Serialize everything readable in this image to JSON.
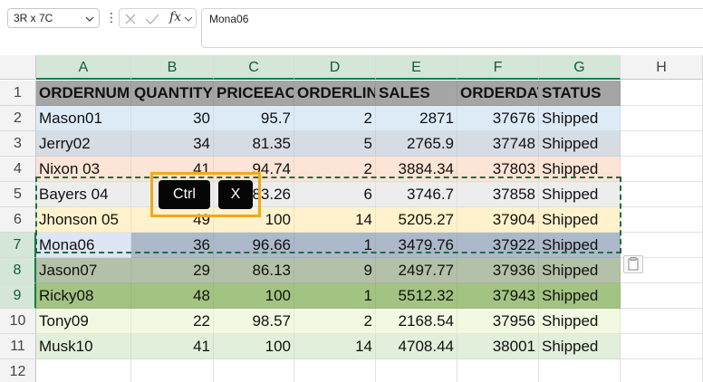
{
  "formula_bar": {
    "name_box": "3R x 7C",
    "content": "Mona06",
    "fx": "fx"
  },
  "columns": [
    "A",
    "B",
    "C",
    "D",
    "E",
    "F",
    "G",
    "H"
  ],
  "selected_columns": [
    "A",
    "B",
    "C",
    "D",
    "E",
    "F",
    "G"
  ],
  "selected_rows": [
    7,
    8,
    9
  ],
  "header_row": [
    "ORDERNUMBER",
    "QUANTITY",
    "PRICEEACH",
    "ORDERLINE",
    "SALES",
    "ORDERDATE",
    "STATUS"
  ],
  "rows": [
    {
      "num": "1"
    },
    {
      "num": "2",
      "cells": [
        "Mason01",
        "30",
        "95.7",
        "2",
        "2871",
        "37676",
        "Shipped"
      ],
      "color": "#ddebf7"
    },
    {
      "num": "3",
      "cells": [
        "Jerry02",
        "34",
        "81.35",
        "5",
        "2765.9",
        "37748",
        "Shipped"
      ],
      "color": "#d6dce4"
    },
    {
      "num": "4",
      "cells": [
        "Nixon 03",
        "41",
        "94.74",
        "2",
        "3884.34",
        "37803",
        "Shipped"
      ],
      "color": "#fce4d6"
    },
    {
      "num": "5",
      "cells": [
        "Bayers 04",
        "",
        "83.26",
        "6",
        "3746.7",
        "37858",
        "Shipped"
      ],
      "color": "#ededed"
    },
    {
      "num": "6",
      "cells": [
        "Jhonson 05",
        "49",
        "100",
        "14",
        "5205.27",
        "37904",
        "Shipped"
      ],
      "color": "#fff2cc"
    },
    {
      "num": "7",
      "cells": [
        "Mona06",
        "36",
        "96.66",
        "1",
        "3479.76",
        "37922",
        "Shipped"
      ],
      "color": "#acb9ca",
      "first_color": "#dde6f4"
    },
    {
      "num": "8",
      "cells": [
        "Jason07",
        "29",
        "86.13",
        "9",
        "2497.77",
        "37936",
        "Shipped"
      ],
      "color": "#b2c1a8"
    },
    {
      "num": "9",
      "cells": [
        "Ricky08",
        "48",
        "100",
        "1",
        "5512.32",
        "37943",
        "Shipped"
      ],
      "color": "#a3c383"
    },
    {
      "num": "10",
      "cells": [
        "Tony09",
        "22",
        "98.57",
        "2",
        "2168.54",
        "37956",
        "Shipped"
      ],
      "color": "#f2f8e2"
    },
    {
      "num": "11",
      "cells": [
        "Musk10",
        "41",
        "100",
        "14",
        "4708.44",
        "38001",
        "Shipped"
      ],
      "color": "#e2efda"
    },
    {
      "num": "12"
    }
  ],
  "header_fill": "#a5a5a5",
  "accent": "#137e43",
  "keys": [
    "Ctrl",
    "X"
  ]
}
